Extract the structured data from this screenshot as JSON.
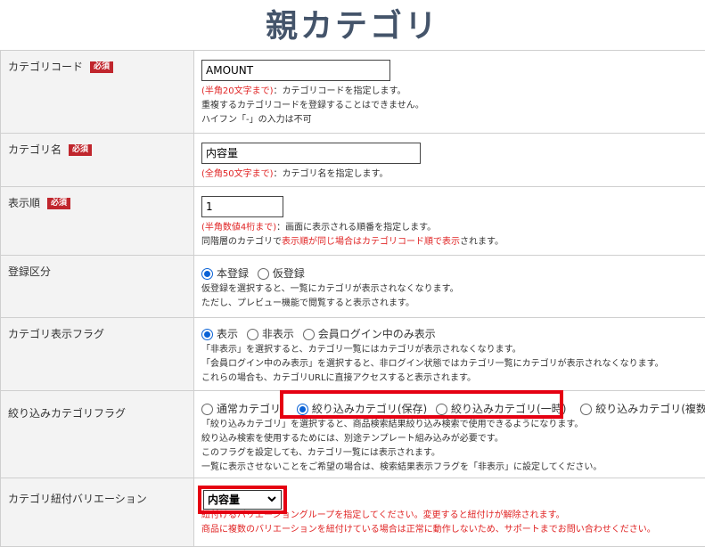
{
  "page_title": "親カテゴリ",
  "required_badge": "必須",
  "rows": {
    "code": {
      "label": "カテゴリコード",
      "value": "AMOUNT",
      "note_red": "(半角20文字まで)",
      "note_after": "：カテゴリコードを指定します。",
      "note2": "重複するカテゴリコードを登録することはできません。",
      "note3": "ハイフン「-」の入力は不可"
    },
    "name": {
      "label": "カテゴリ名",
      "value": "内容量",
      "note_red": "(全角50文字まで)",
      "note_after": "：カテゴリ名を指定します。"
    },
    "order": {
      "label": "表示順",
      "value": "1",
      "note_red": "(半角数値4桁まで)",
      "note_after": "：画面に表示される順番を指定します。",
      "note2_a": "同階層のカテゴリで",
      "note2_b": "表示順が同じ場合はカテゴリコード順で表示",
      "note2_c": "されます。"
    },
    "registration": {
      "label": "登録区分",
      "options": [
        "本登録",
        "仮登録"
      ],
      "selected": "本登録",
      "note1": "仮登録を選択すると、一覧にカテゴリが表示されなくなります。",
      "note2": "ただし、プレビュー機能で閲覧すると表示されます。"
    },
    "display_flag": {
      "label": "カテゴリ表示フラグ",
      "options": [
        "表示",
        "非表示",
        "会員ログイン中のみ表示"
      ],
      "selected": "表示",
      "note1": "「非表示」を選択すると、カテゴリ一覧にはカテゴリが表示されなくなります。",
      "note2": "「会員ログイン中のみ表示」を選択すると、非ログイン状態ではカテゴリ一覧にカテゴリが表示されなくなります。",
      "note3": "これらの場合も、カテゴリURLに直接アクセスすると表示されます。"
    },
    "filter_flag": {
      "label": "絞り込みカテゴリフラグ",
      "options": [
        "通常カテゴリ",
        "絞り込みカテゴリ(保存)",
        "絞り込みカテゴリ(一時)",
        "絞り込みカテゴリ(複数)"
      ],
      "selected": "絞り込みカテゴリ(保存)",
      "note1": "「絞り込みカテゴリ」を選択すると、商品検索結果絞り込み検索で使用できるようになります。",
      "note2": "絞り込み検索を使用するためには、別途テンプレート組み込みが必要です。",
      "note3": "このフラグを設定しても、カテゴリ一覧には表示されます。",
      "note4": "一覧に表示させないことをご希望の場合は、検索結果表示フラグを「非表示」に設定してください。"
    },
    "variation": {
      "label": "カテゴリ紐付バリエーション",
      "selected": "内容量",
      "note1": "紐付けるバリエーショングループを指定してください。変更すると紐付けが解除されます。",
      "note2": "商品に複数のバリエーションを紐付けている場合は正常に動作しないため、サポートまでお問い合わせください。"
    }
  },
  "colors": {
    "title": "#44546a",
    "required_badge": "#c0262d",
    "note_red": "#e02424",
    "highlight": "#e50012",
    "radio_checked": "#0a62d6",
    "label_bg": "#f3f3f3"
  }
}
